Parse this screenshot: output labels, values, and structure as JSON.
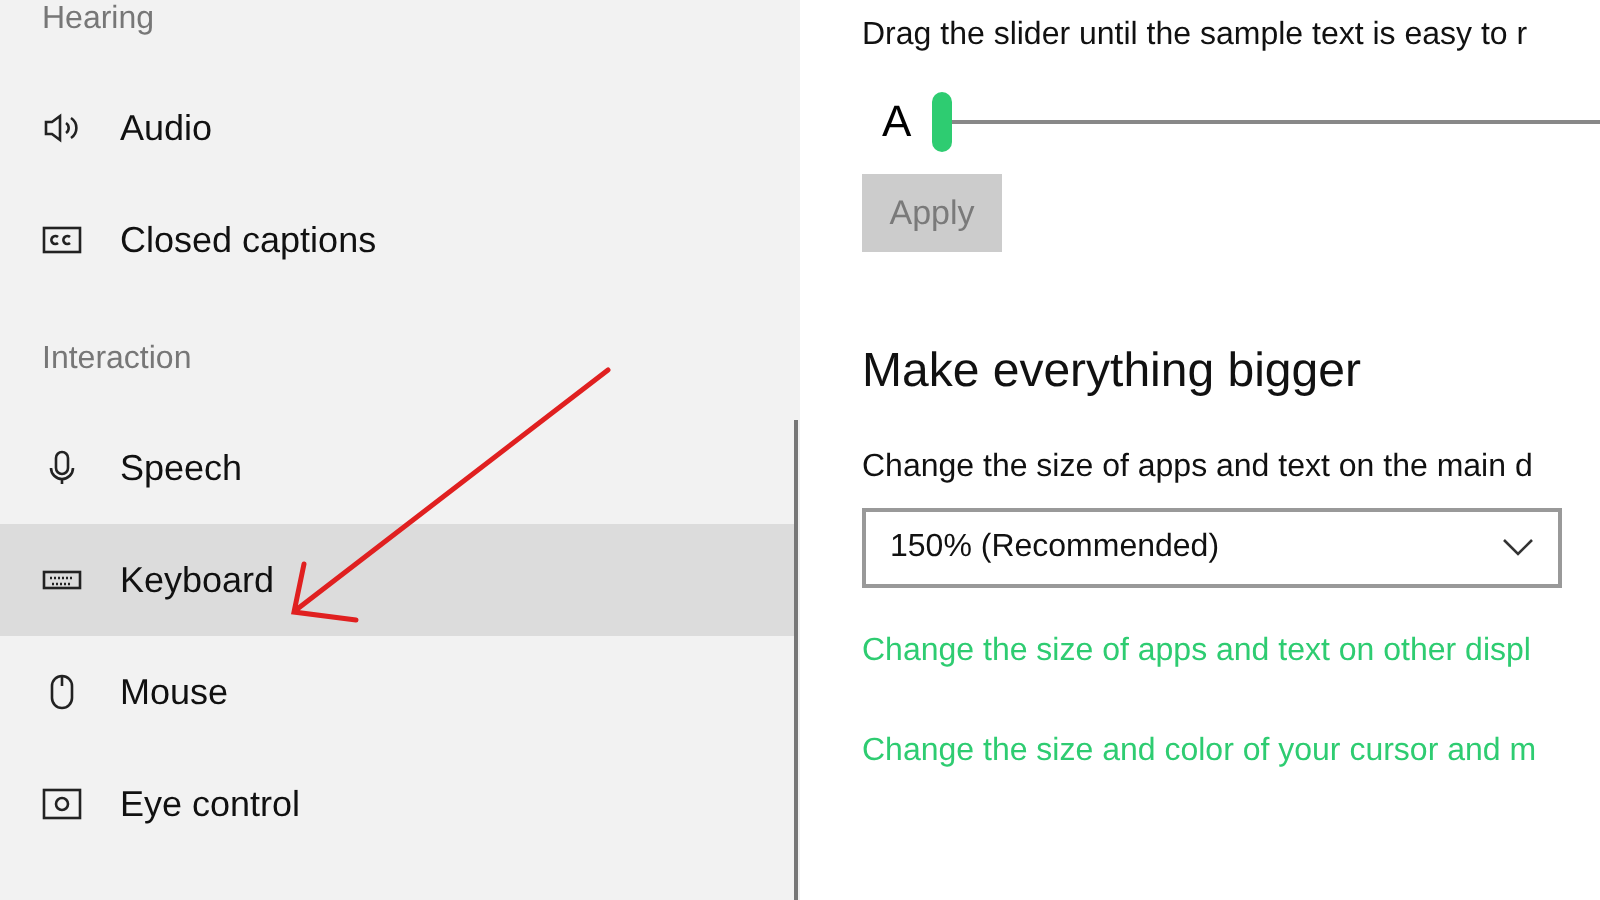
{
  "sidebar": {
    "sections": [
      {
        "heading": "Hearing",
        "items": [
          {
            "kind": "speaker",
            "label": "Audio",
            "selected": false
          },
          {
            "kind": "cc",
            "label": "Closed captions",
            "selected": false
          }
        ]
      },
      {
        "heading": "Interaction",
        "items": [
          {
            "kind": "mic",
            "label": "Speech",
            "selected": false
          },
          {
            "kind": "keyboard",
            "label": "Keyboard",
            "selected": true
          },
          {
            "kind": "mouse",
            "label": "Mouse",
            "selected": false
          },
          {
            "kind": "eye",
            "label": "Eye control",
            "selected": false
          }
        ]
      }
    ]
  },
  "text_size": {
    "instruction": "Drag the slider until the sample text is easy to r",
    "slider_label": "A",
    "level": 0,
    "apply": {
      "label": "Apply",
      "disabled": true
    }
  },
  "make_bigger": {
    "title": "Make everything bigger",
    "dropdown_label": "Change the size of apps and text on the main d",
    "dropdown_value": "150% (Recommended)",
    "links": [
      "Change the size of apps and text on other displ",
      "Change the size and color of your cursor and m"
    ]
  }
}
